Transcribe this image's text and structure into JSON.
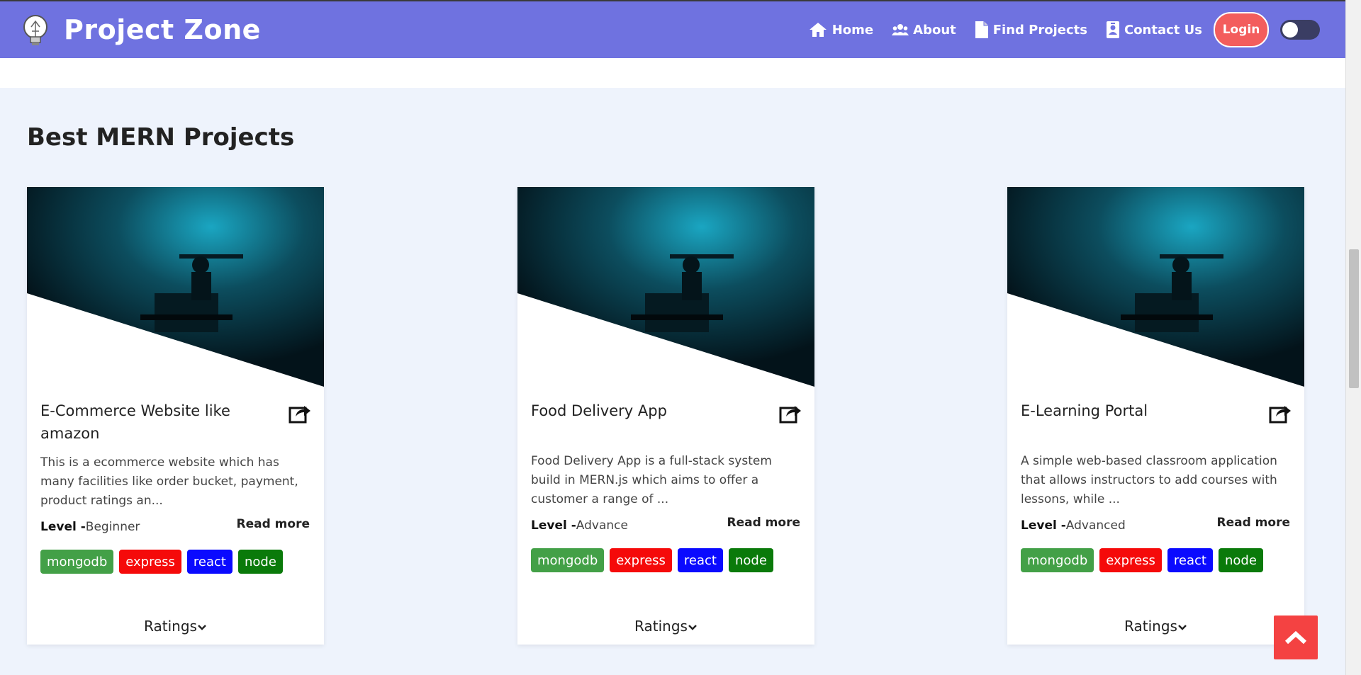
{
  "navbar": {
    "brand_title": "Project Zone",
    "links": [
      {
        "label": "Home",
        "icon": "home-icon"
      },
      {
        "label": "About",
        "icon": "users-icon"
      },
      {
        "label": "Find Projects",
        "icon": "file-icon"
      },
      {
        "label": "Contact Us",
        "icon": "contact-card-icon"
      }
    ],
    "login_label": "Login",
    "theme_toggle": "off",
    "colors": {
      "navbar": "#6f72e0",
      "login": "#f35d5d"
    }
  },
  "section": {
    "title": "Best MERN Projects"
  },
  "cards": [
    {
      "title": "E-Commerce Website like amazon",
      "description": "This is a ecommerce website which has many facilities like order bucket, payment, product ratings an...",
      "level_label": "Level -",
      "level": "Beginner",
      "read_more": "Read more",
      "tags": [
        "mongodb",
        "express",
        "react",
        "node"
      ],
      "ratings_label": "Ratings"
    },
    {
      "title": "Food Delivery App",
      "description": "Food Delivery App is a full-stack system build in MERN.js which aims to offer a customer a range of ...",
      "level_label": "Level -",
      "level": "Advance",
      "read_more": "Read more",
      "tags": [
        "mongodb",
        "express",
        "react",
        "node"
      ],
      "ratings_label": "Ratings"
    },
    {
      "title": "E-Learning Portal",
      "description": "A simple web-based classroom application that allows instructors to add courses with lessons, while ...",
      "level_label": "Level -",
      "level": "Advanced",
      "read_more": "Read more",
      "tags": [
        "mongodb",
        "express",
        "react",
        "node"
      ],
      "ratings_label": "Ratings"
    }
  ],
  "tag_colors": {
    "mongodb": "#43a047",
    "express": "#f50a0a",
    "react": "#0a0aff",
    "node": "#0a7a0a"
  }
}
